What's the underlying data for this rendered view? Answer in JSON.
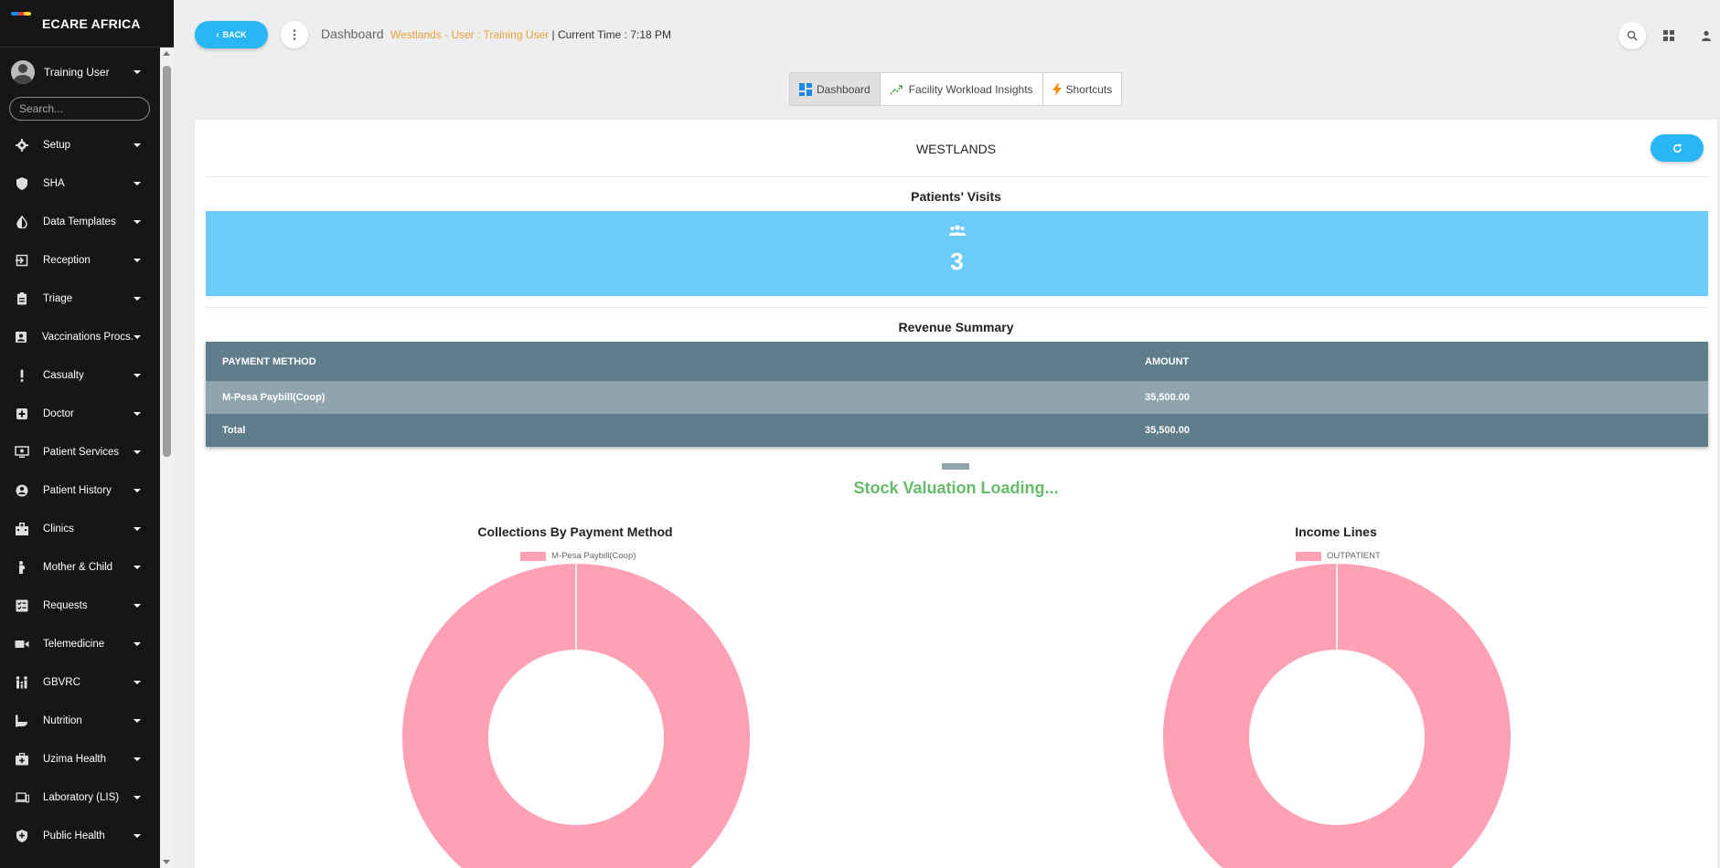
{
  "brand": {
    "name": "ECARE AFRICA"
  },
  "sidebar": {
    "user": "Training User",
    "search_placeholder": "Search...",
    "items": [
      {
        "label": "Setup",
        "icon": "gear-icon"
      },
      {
        "label": "SHA",
        "icon": "shield-icon"
      },
      {
        "label": "Data Templates",
        "icon": "contrast-icon"
      },
      {
        "label": "Reception",
        "icon": "login-icon"
      },
      {
        "label": "Triage",
        "icon": "clipboard-icon"
      },
      {
        "label": "Vaccinations Procs.",
        "icon": "contact-card-icon"
      },
      {
        "label": "Casualty",
        "icon": "exclamation-icon"
      },
      {
        "label": "Doctor",
        "icon": "medical-plus-icon"
      },
      {
        "label": "Patient Services",
        "icon": "monitor-icon"
      },
      {
        "label": "Patient History",
        "icon": "account-circle-icon"
      },
      {
        "label": "Clinics",
        "icon": "hospital-icon"
      },
      {
        "label": "Mother & Child",
        "icon": "pregnant-icon"
      },
      {
        "label": "Requests",
        "icon": "checklist-icon"
      },
      {
        "label": "Telemedicine",
        "icon": "video-camera-icon"
      },
      {
        "label": "GBVRC",
        "icon": "family-icon"
      },
      {
        "label": "Nutrition",
        "icon": "nutrition-icon"
      },
      {
        "label": "Uzima Health",
        "icon": "medical-bag-icon"
      },
      {
        "label": "Laboratory (LIS)",
        "icon": "laptop-icon"
      },
      {
        "label": "Public Health",
        "icon": "shield-plus-icon"
      }
    ]
  },
  "topbar": {
    "back_label": "BACK",
    "page_title": "Dashboard",
    "location_text": "Westlands - User : Training User",
    "separator": " | ",
    "time_text": "Current Time : 7:18 PM"
  },
  "tabs": [
    {
      "label": "Dashboard",
      "icon": "dashboard-icon",
      "active": true
    },
    {
      "label": "Facility Workload Insights",
      "icon": "trending-icon",
      "active": false
    },
    {
      "label": "Shortcuts",
      "icon": "lightning-icon",
      "active": false
    }
  ],
  "main": {
    "facility_name": "WESTLANDS",
    "visits": {
      "title": "Patients' Visits",
      "value": "3"
    },
    "revenue": {
      "title": "Revenue Summary",
      "headers": [
        "PAYMENT METHOD",
        "AMOUNT"
      ],
      "rows": [
        {
          "method": "M-Pesa Paybill(Coop)",
          "amount": "35,500.00"
        }
      ],
      "total": {
        "label": "Total",
        "amount": "35,500.00"
      }
    },
    "stock_loading": "Stock Valuation Loading..."
  },
  "charts": {
    "colors": {
      "pink": "#ffa1b5",
      "accent": "#29b6f6",
      "visits_bg": "#6bcbfa",
      "table_dark": "#607d8b",
      "table_light": "#90a4ae",
      "loading_green": "#66bb6a",
      "location_orange": "#e6a23c"
    }
  },
  "chart_data": [
    {
      "type": "pie",
      "title": "Collections By Payment Method",
      "categories": [
        "M-Pesa Paybill(Coop)"
      ],
      "values": [
        35500
      ],
      "legend": "top"
    },
    {
      "type": "pie",
      "title": "Income Lines",
      "categories": [
        "OUTPATIENT"
      ],
      "values": [
        1
      ],
      "legend": "top"
    }
  ]
}
